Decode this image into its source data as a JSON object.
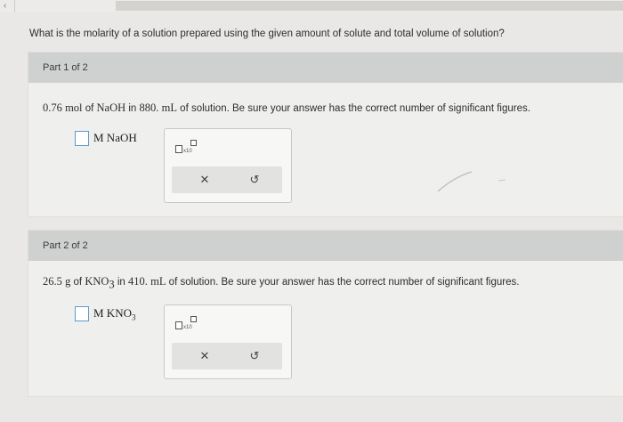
{
  "question": "What is the molarity of a solution prepared using the given amount of solute and total volume of solution?",
  "parts": [
    {
      "header": "Part 1 of 2",
      "amount": "0.76",
      "amount_unit": "mol",
      "solute": "NaOH",
      "solute_sub": "",
      "connector_in": "in",
      "volume": "880.",
      "volume_unit": "mL",
      "prompt_suffix": "of solution. Be sure your answer has the correct number of significant figures.",
      "answer_unit": "M NaOH",
      "answer_unit_sub": ""
    },
    {
      "header": "Part 2 of 2",
      "amount": "26.5",
      "amount_unit": "g",
      "solute": "KNO",
      "solute_sub": "3",
      "connector_in": "in",
      "volume": "410.",
      "volume_unit": "mL",
      "prompt_suffix": "of solution. Be sure your answer has the correct number of significant figures.",
      "answer_unit": "M KNO",
      "answer_unit_sub": "3"
    }
  ],
  "toolbar": {
    "sci_label": "x10",
    "clear_symbol": "✕",
    "undo_symbol": "↺"
  },
  "colors": {
    "header_bg": "#cfd1d0",
    "card_bg": "#efefed",
    "answer_border": "#5a9bcf"
  }
}
